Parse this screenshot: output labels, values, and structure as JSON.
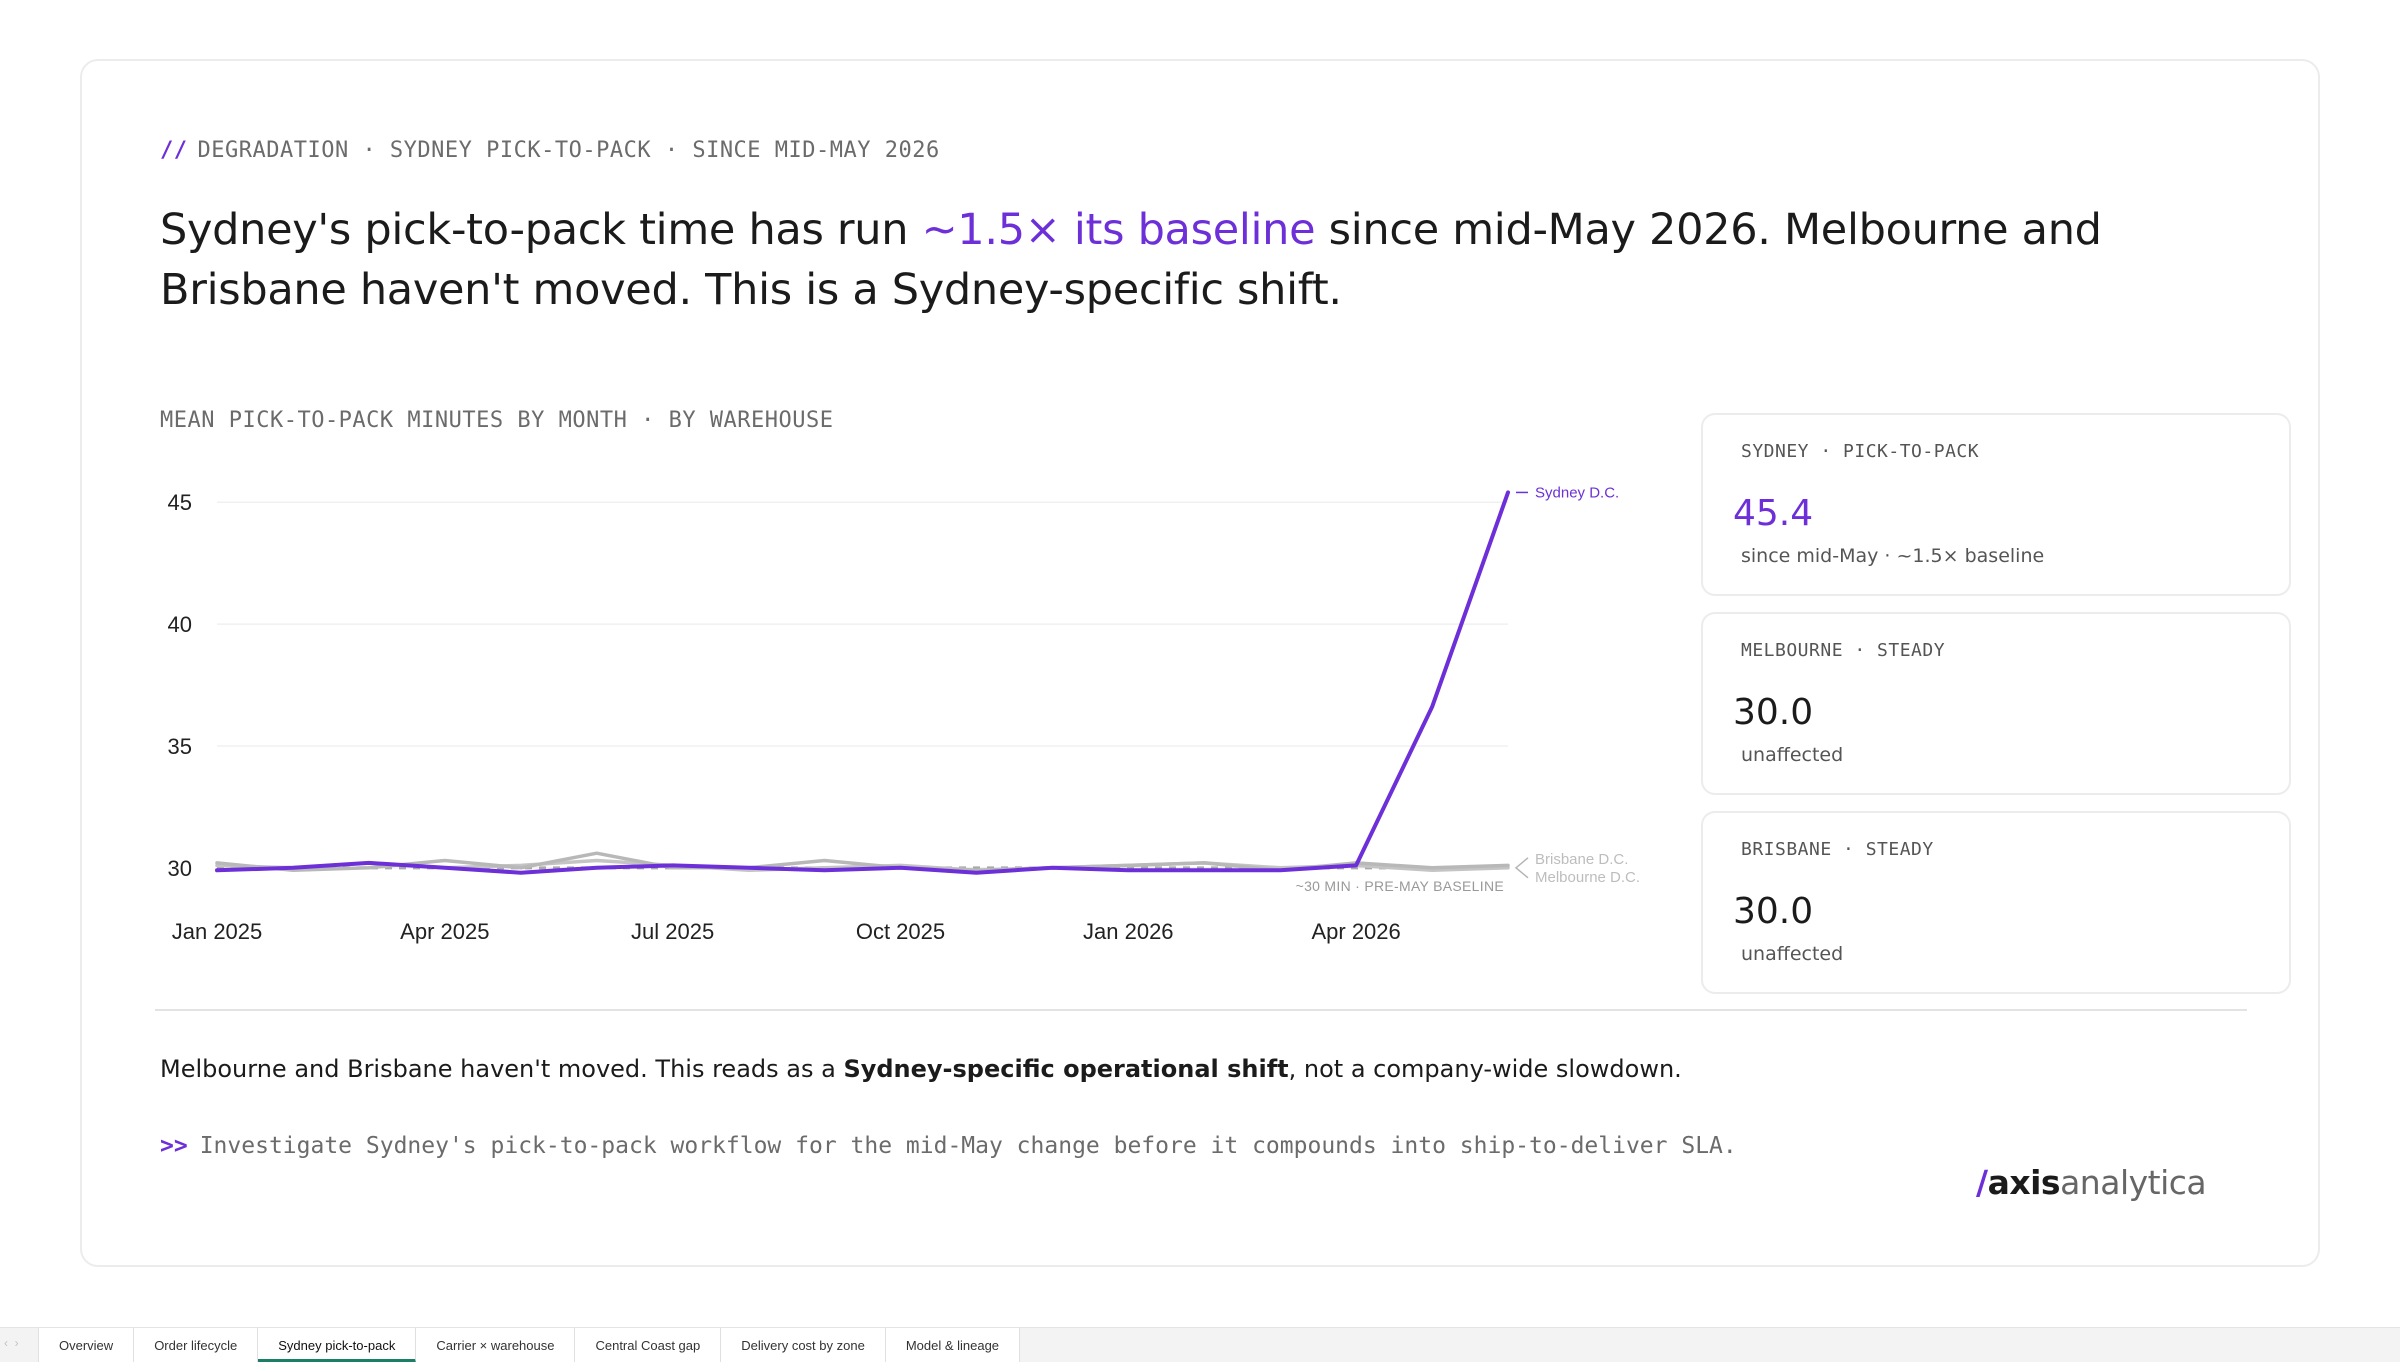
{
  "eyebrow": {
    "slashes": "//",
    "text": "DEGRADATION · SYDNEY PICK-TO-PACK · SINCE MID-MAY 2026"
  },
  "headline": {
    "before": "Sydney's pick-to-pack time has run ",
    "accent": "~1.5× its baseline",
    "after": " since mid-May 2026. Melbourne and Brisbane haven't moved. This is a Sydney-specific shift."
  },
  "chart_data": {
    "type": "line",
    "title": "MEAN PICK-TO-PACK MINUTES BY MONTH · BY WAREHOUSE",
    "xlabel": "",
    "ylabel": "",
    "x": [
      "2025-01",
      "2025-02",
      "2025-03",
      "2025-04",
      "2025-05",
      "2025-06",
      "2025-07",
      "2025-08",
      "2025-09",
      "2025-10",
      "2025-11",
      "2025-12",
      "2026-01",
      "2026-02",
      "2026-03",
      "2026-04",
      "2026-05",
      "2026-06"
    ],
    "x_tick_labels": [
      "Jan 2025",
      "Apr 2025",
      "Jul 2025",
      "Oct 2025",
      "Jan 2026",
      "Apr 2026"
    ],
    "x_tick_index": [
      0,
      3,
      6,
      9,
      12,
      15
    ],
    "y_ticks": [
      30,
      35,
      40,
      45
    ],
    "ylim": [
      29.5,
      45.5
    ],
    "grid": true,
    "baseline": {
      "value": 30,
      "label": "~30 MIN · PRE-MAY BASELINE"
    },
    "series": [
      {
        "name": "Melbourne D.C.",
        "color": "#c4c4c4",
        "values": [
          30.1,
          30.0,
          30.2,
          30.0,
          30.1,
          30.3,
          30.1,
          29.9,
          30.0,
          30.1,
          29.9,
          30.0,
          30.1,
          30.2,
          30.0,
          30.1,
          29.9,
          30.0
        ]
      },
      {
        "name": "Brisbane D.C.",
        "color": "#b8b8b8",
        "values": [
          30.2,
          29.9,
          30.0,
          30.3,
          30.0,
          30.6,
          30.0,
          30.0,
          30.3,
          30.0,
          29.9,
          30.0,
          30.1,
          30.2,
          29.9,
          30.2,
          30.0,
          30.1
        ]
      },
      {
        "name": "Sydney D.C.",
        "color": "#6d2fd8",
        "values": [
          29.9,
          30.0,
          30.2,
          30.0,
          29.8,
          30.0,
          30.1,
          30.0,
          29.9,
          30.0,
          29.8,
          30.0,
          29.9,
          29.9,
          29.9,
          30.1,
          36.6,
          45.4
        ]
      }
    ]
  },
  "kpis": [
    {
      "label": "SYDNEY · PICK-TO-PACK",
      "value": "45.4",
      "sub": "since mid-May · ~1.5× baseline"
    },
    {
      "label": "MELBOURNE · STEADY",
      "value": "30.0",
      "sub": "unaffected"
    },
    {
      "label": "BRISBANE · STEADY",
      "value": "30.0",
      "sub": "unaffected"
    }
  ],
  "note": {
    "before": "Melbourne and Brisbane haven't moved. This reads as a ",
    "bold": "Sydney-specific operational shift",
    "after": ", not a company-wide slowdown."
  },
  "action": {
    "prompt": ">>",
    "text": "Investigate Sydney's pick-to-pack workflow for the mid-May change before it compounds into ship-to-deliver SLA."
  },
  "logo": {
    "slash": "/",
    "part1": "axis",
    "part2": "analytica"
  },
  "tabs": [
    {
      "label": "Overview",
      "active": false
    },
    {
      "label": "Order lifecycle",
      "active": false
    },
    {
      "label": "Sydney pick-to-pack",
      "active": true
    },
    {
      "label": "Carrier × warehouse",
      "active": false
    },
    {
      "label": "Central Coast gap",
      "active": false
    },
    {
      "label": "Delivery cost by zone",
      "active": false
    },
    {
      "label": "Model & lineage",
      "active": false
    }
  ],
  "tab_nav": {
    "prev": "‹",
    "next": "›"
  },
  "colors": {
    "accent": "#6d2fd8",
    "muted_series": "#c4c4c4",
    "active_tab": "#1a7f64"
  }
}
